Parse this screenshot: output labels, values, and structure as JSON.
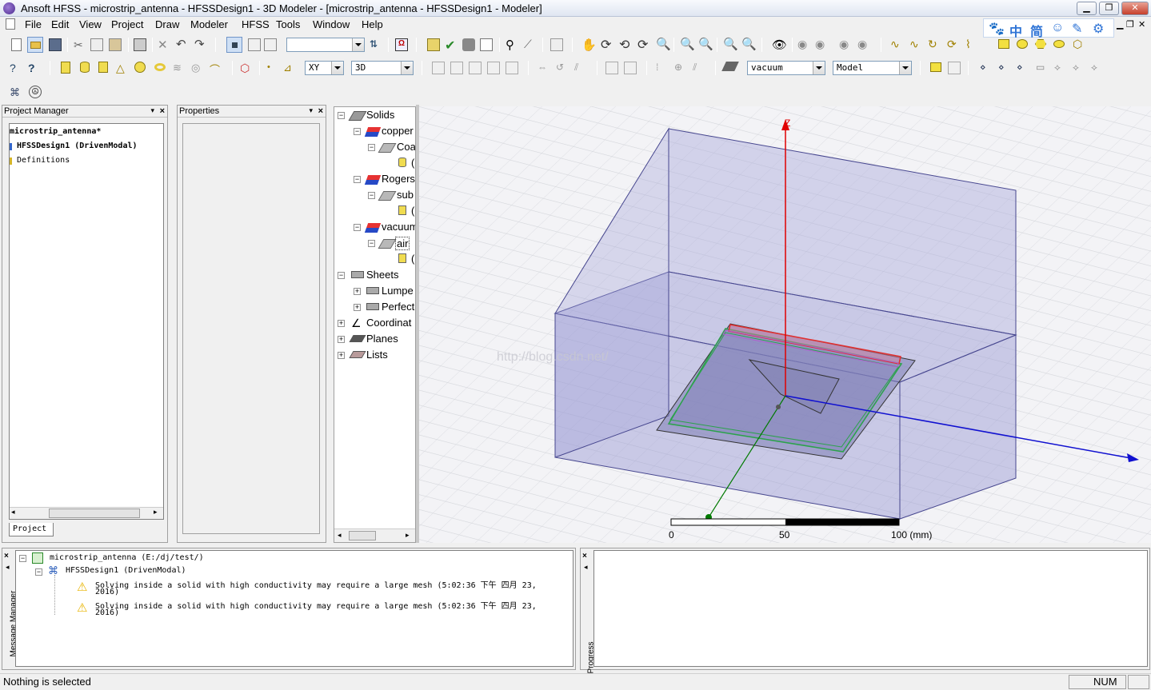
{
  "window": {
    "title": "Ansoft HFSS  - microstrip_antenna - HFSSDesign1 - 3D Modeler - [microstrip_antenna - HFSSDesign1 - Modeler]"
  },
  "menu": [
    "File",
    "Edit",
    "View",
    "Project",
    "Draw",
    "Modeler",
    "HFSS",
    "Tools",
    "Window",
    "Help"
  ],
  "ime": {
    "zh": "中",
    "jian": "简"
  },
  "toolbar": {
    "plane": "XY",
    "view": "3D",
    "material": "vacuum",
    "model": "Model"
  },
  "project_manager": {
    "title": "Project Manager",
    "project": "microstrip_antenna*",
    "design": "HFSSDesign1 (DrivenModal)",
    "definitions": "Definitions",
    "tab": "Project"
  },
  "properties": {
    "title": "Properties"
  },
  "model_tree": {
    "solids": "Solids",
    "copper": "copper",
    "coa": "Coa",
    "rogers": "Rogers",
    "sub": "sub",
    "vacuum": "vacuum",
    "air": "air",
    "sheets": "Sheets",
    "lumped": "Lumpe",
    "perfect": "Perfect",
    "coord": "Coordinat",
    "planes": "Planes",
    "lists": "Lists",
    "trunc": "("
  },
  "viewport": {
    "z_label": "Z",
    "scale": {
      "s0": "0",
      "s50": "50",
      "s100": "100 (mm)"
    },
    "watermark": "http://blog.csdn.net/"
  },
  "messages": {
    "panel_label": "Message Manager",
    "project": "microstrip_antenna (E:/dj/test/)",
    "design": "HFSSDesign1 (DrivenModal)",
    "items": [
      {
        "line1": "Solving inside a solid with high conductivity may require a large mesh (5:02:36 下午  四月 23,",
        "line2": "2016)"
      },
      {
        "line1": "Solving inside a solid with high conductivity may require a large mesh (5:02:36 下午  四月 23,",
        "line2": "2016)"
      }
    ]
  },
  "progress": {
    "label": "Progress"
  },
  "status": {
    "text": "Nothing is selected",
    "num": "NUM"
  }
}
